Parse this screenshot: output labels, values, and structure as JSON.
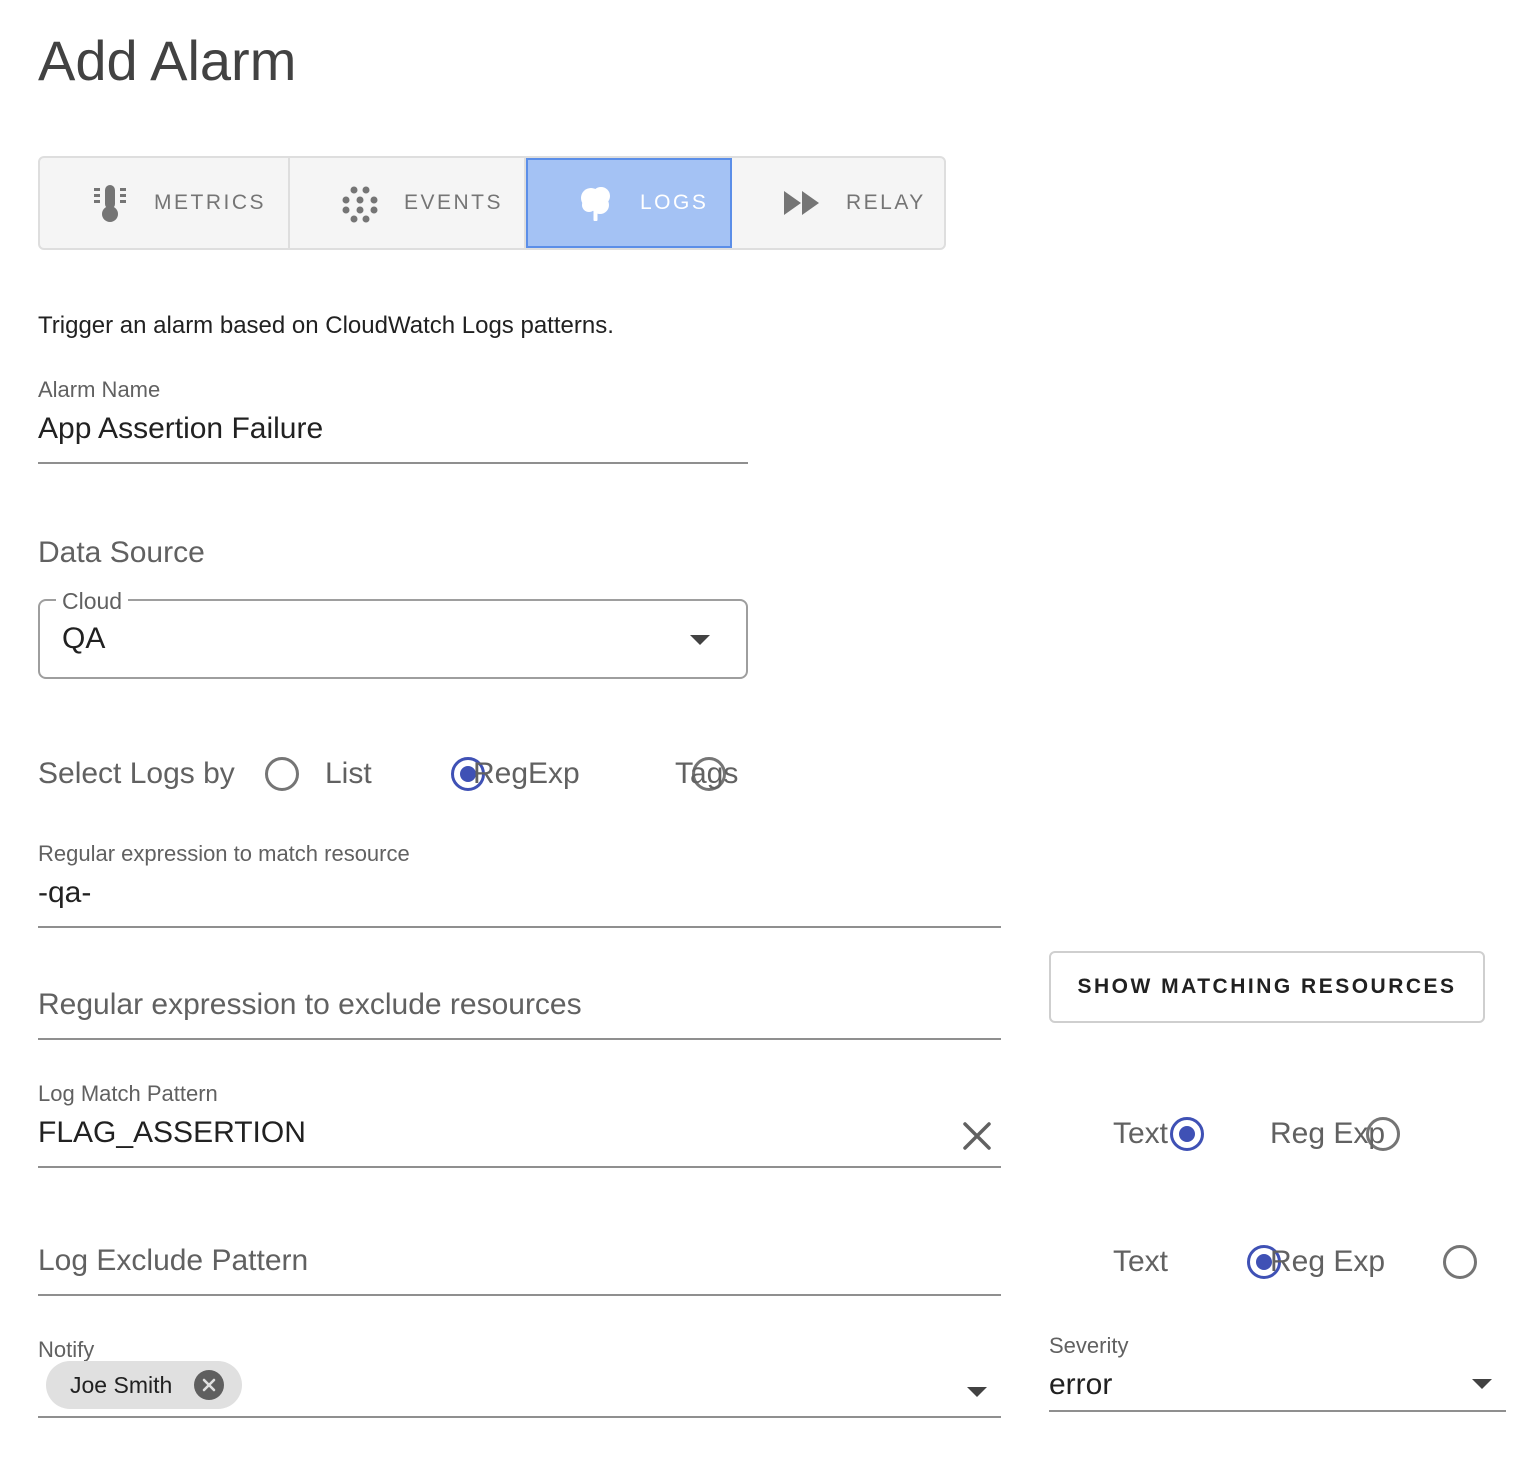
{
  "page": {
    "title": "Add Alarm"
  },
  "tabs": [
    {
      "label": "METRICS",
      "icon": "thermometer-icon",
      "active": false
    },
    {
      "label": "EVENTS",
      "icon": "dots-grid-icon",
      "active": false
    },
    {
      "label": "LOGS",
      "icon": "tree-icon",
      "active": true
    },
    {
      "label": "RELAY",
      "icon": "fast-forward-icon",
      "active": false
    }
  ],
  "description": "Trigger an alarm based on CloudWatch Logs patterns.",
  "alarm_name": {
    "label": "Alarm Name",
    "value": "App Assertion Failure"
  },
  "data_source": {
    "heading": "Data Source",
    "cloud": {
      "label": "Cloud",
      "value": "QA"
    }
  },
  "select_logs_by": {
    "label": "Select Logs by",
    "options": [
      "List",
      "RegExp",
      "Tags"
    ],
    "selected": "RegExp"
  },
  "regex_match": {
    "label": "Regular expression to match resource",
    "value": "-qa-"
  },
  "regex_exclude": {
    "placeholder": "Regular expression to exclude resources"
  },
  "show_matching_button": "SHOW MATCHING RESOURCES",
  "log_match_pattern": {
    "label": "Log Match Pattern",
    "value": "FLAG_ASSERTION",
    "mode_options": [
      "Text",
      "Reg Exp"
    ],
    "mode_selected": "Text"
  },
  "log_exclude_pattern": {
    "placeholder": "Log Exclude Pattern",
    "mode_options": [
      "Text",
      "Reg Exp"
    ],
    "mode_selected": "Text"
  },
  "notify": {
    "label": "Notify",
    "chips": [
      "Joe Smith"
    ]
  },
  "severity": {
    "label": "Severity",
    "value": "error"
  },
  "colors": {
    "accent": "#3f51b5",
    "active_tab_bg": "#a4c2f4",
    "active_tab_border": "#5b8ee8"
  }
}
